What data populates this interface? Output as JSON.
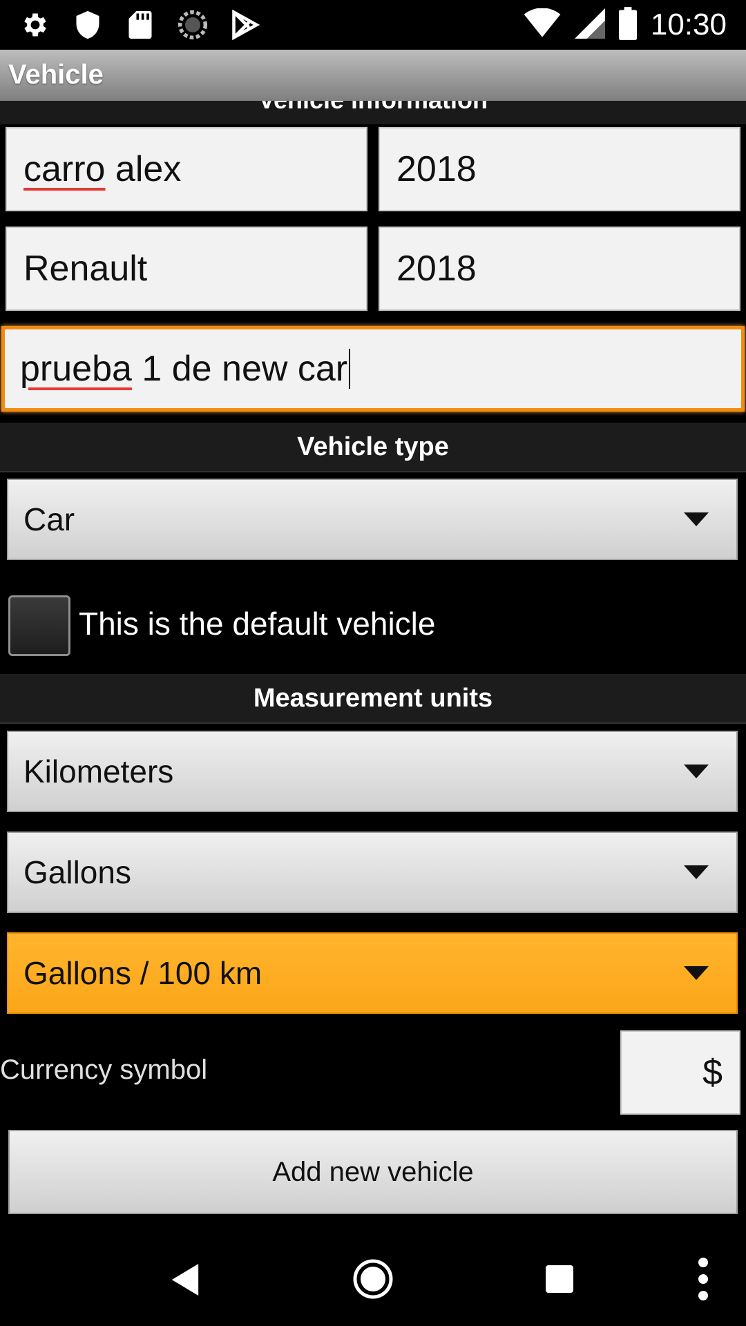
{
  "status_bar": {
    "time": "10:30",
    "icons": [
      "gear-icon",
      "shield-icon",
      "sd-card-icon",
      "sync-icon",
      "play-store-icon",
      "wifi-icon",
      "cell-signal-icon",
      "battery-icon"
    ]
  },
  "action_bar": {
    "title": "Vehicle",
    "cut_section_title": "Vehicle information"
  },
  "form": {
    "name": "carro alex",
    "year": "2018",
    "make": "Renault",
    "model_year": "2018",
    "description_underlined": "prueba",
    "description_rest": " 1 de new car",
    "name_underlined": "carro",
    "name_rest": " alex"
  },
  "vehicle_type": {
    "header": "Vehicle type",
    "selected": "Car"
  },
  "default_vehicle": {
    "label": "This is the default vehicle",
    "checked": false
  },
  "measurement_units": {
    "header": "Measurement units",
    "distance": "Kilometers",
    "volume": "Gallons",
    "consumption": "Gallons / 100 km"
  },
  "currency": {
    "label": "Currency symbol",
    "value": "$"
  },
  "add_button": "Add new vehicle",
  "colors": {
    "accent": "#fca61a",
    "focus_border": "#f28c10"
  }
}
